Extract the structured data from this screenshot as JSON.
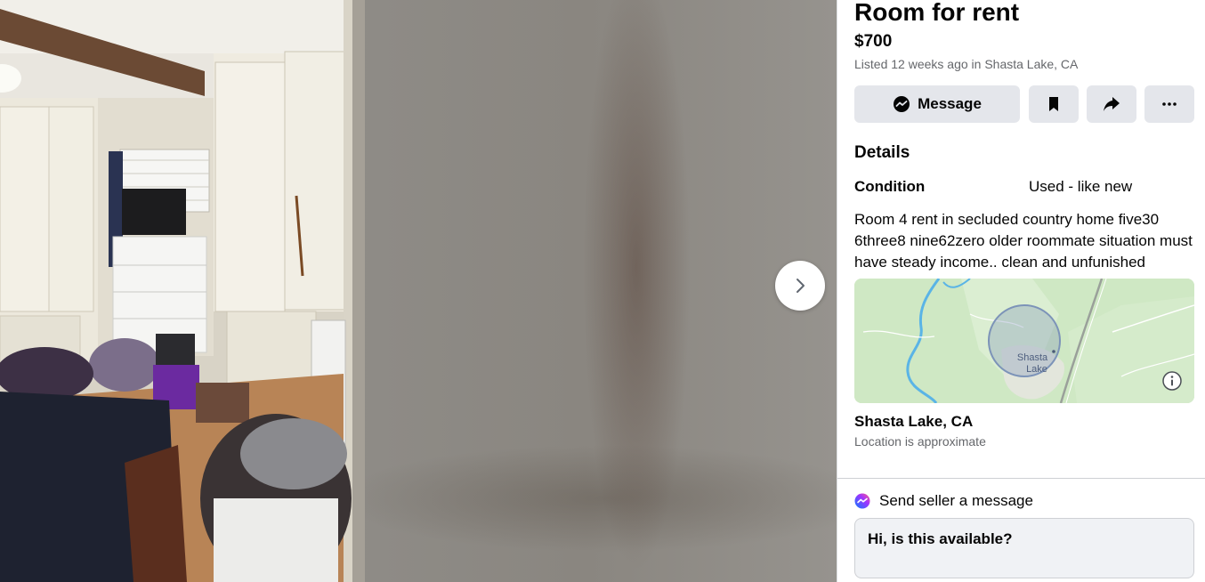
{
  "viewer": {
    "next_icon": "chevron-right-icon"
  },
  "listing": {
    "title": "Room for rent",
    "price": "$700",
    "meta": "Listed 12 weeks ago in Shasta Lake, CA"
  },
  "actions": {
    "message_label": "Message",
    "message_icon": "messenger-icon",
    "save_icon": "bookmark-icon",
    "share_icon": "share-icon",
    "more_icon": "more-dots-icon"
  },
  "details": {
    "heading": "Details",
    "condition_label": "Condition",
    "condition_value": "Used - like new",
    "description": "Room 4 rent in secluded country home five30 6three8 nine62zero older roommate situation must have steady income.. clean and unfunished"
  },
  "map": {
    "label_line1": "Shasta",
    "label_line2": "Lake",
    "info_icon": "info-icon"
  },
  "location": {
    "name": "Shasta Lake, CA",
    "note": "Location is approximate"
  },
  "seller_message": {
    "label": "Send seller a message",
    "input_value": "Hi, is this available?"
  },
  "colors": {
    "button_bg": "#e4e6eb",
    "secondary_text": "#65676b",
    "map_green": "#cfe8c4",
    "map_water": "#5ab4e6"
  }
}
